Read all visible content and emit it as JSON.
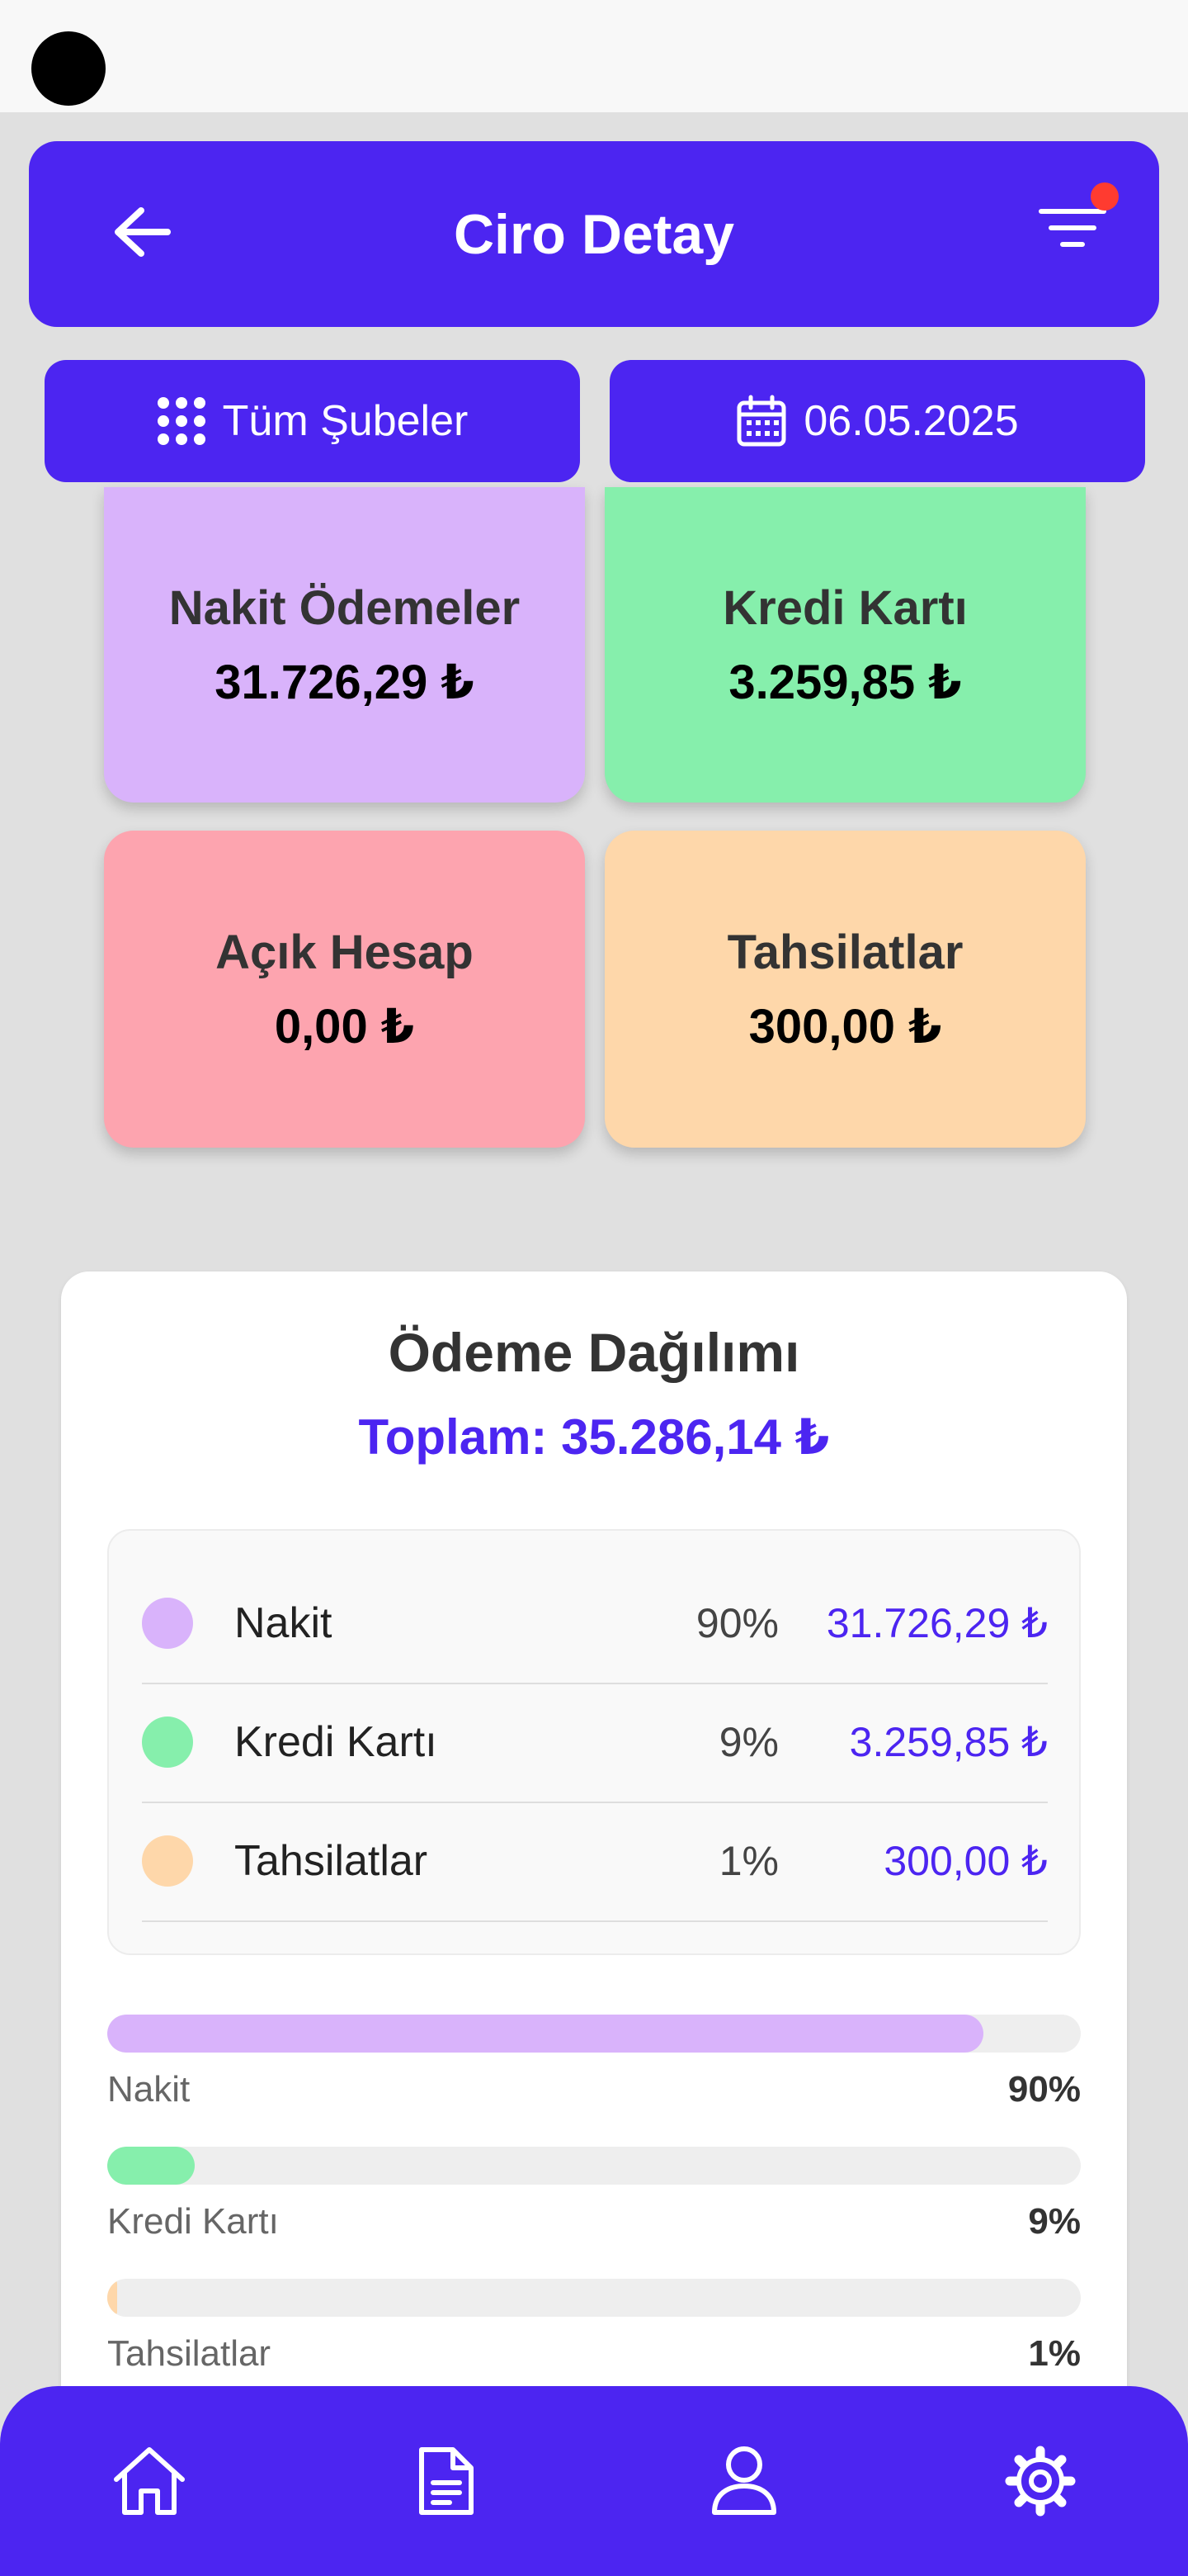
{
  "header": {
    "title": "Ciro Detay",
    "back_icon": "arrow-left-icon",
    "filter_icon": "filter-icon"
  },
  "filters": {
    "branch_label": "Tüm Şubeler",
    "branch_icon": "grid-dots-icon",
    "date_label": "06.05.2025",
    "date_icon": "calendar-icon"
  },
  "cards": [
    {
      "label": "Nakit Ödemeler",
      "value": "31.726,29 ₺",
      "color": "#d9b3fb"
    },
    {
      "label": "Kredi Kartı",
      "value": "3.259,85 ₺",
      "color": "#86efac"
    },
    {
      "label": "Açık Hesap",
      "value": "0,00 ₺",
      "color": "#fda4af"
    },
    {
      "label": "Tahsilatlar",
      "value": "300,00 ₺",
      "color": "#fed7aa"
    }
  ],
  "distribution": {
    "title": "Ödeme Dağılımı",
    "total": "Toplam: 35.286,14 ₺",
    "items": [
      {
        "name": "Nakit",
        "percent": "90%",
        "amount": "31.726,29 ₺",
        "color": "#d9b3fb",
        "fraction": 0.9
      },
      {
        "name": "Kredi Kartı",
        "percent": "9%",
        "amount": "3.259,85 ₺",
        "color": "#86efac",
        "fraction": 0.09
      },
      {
        "name": "Tahsilatlar",
        "percent": "1%",
        "amount": "300,00 ₺",
        "color": "#fed7aa",
        "fraction": 0.01
      }
    ]
  },
  "nav": [
    {
      "icon": "home-icon"
    },
    {
      "icon": "document-icon"
    },
    {
      "icon": "user-icon"
    },
    {
      "icon": "settings-icon"
    }
  ],
  "colors": {
    "primary": "#4c25f1",
    "background": "#e0e0e0",
    "notification": "#ff3b30"
  }
}
